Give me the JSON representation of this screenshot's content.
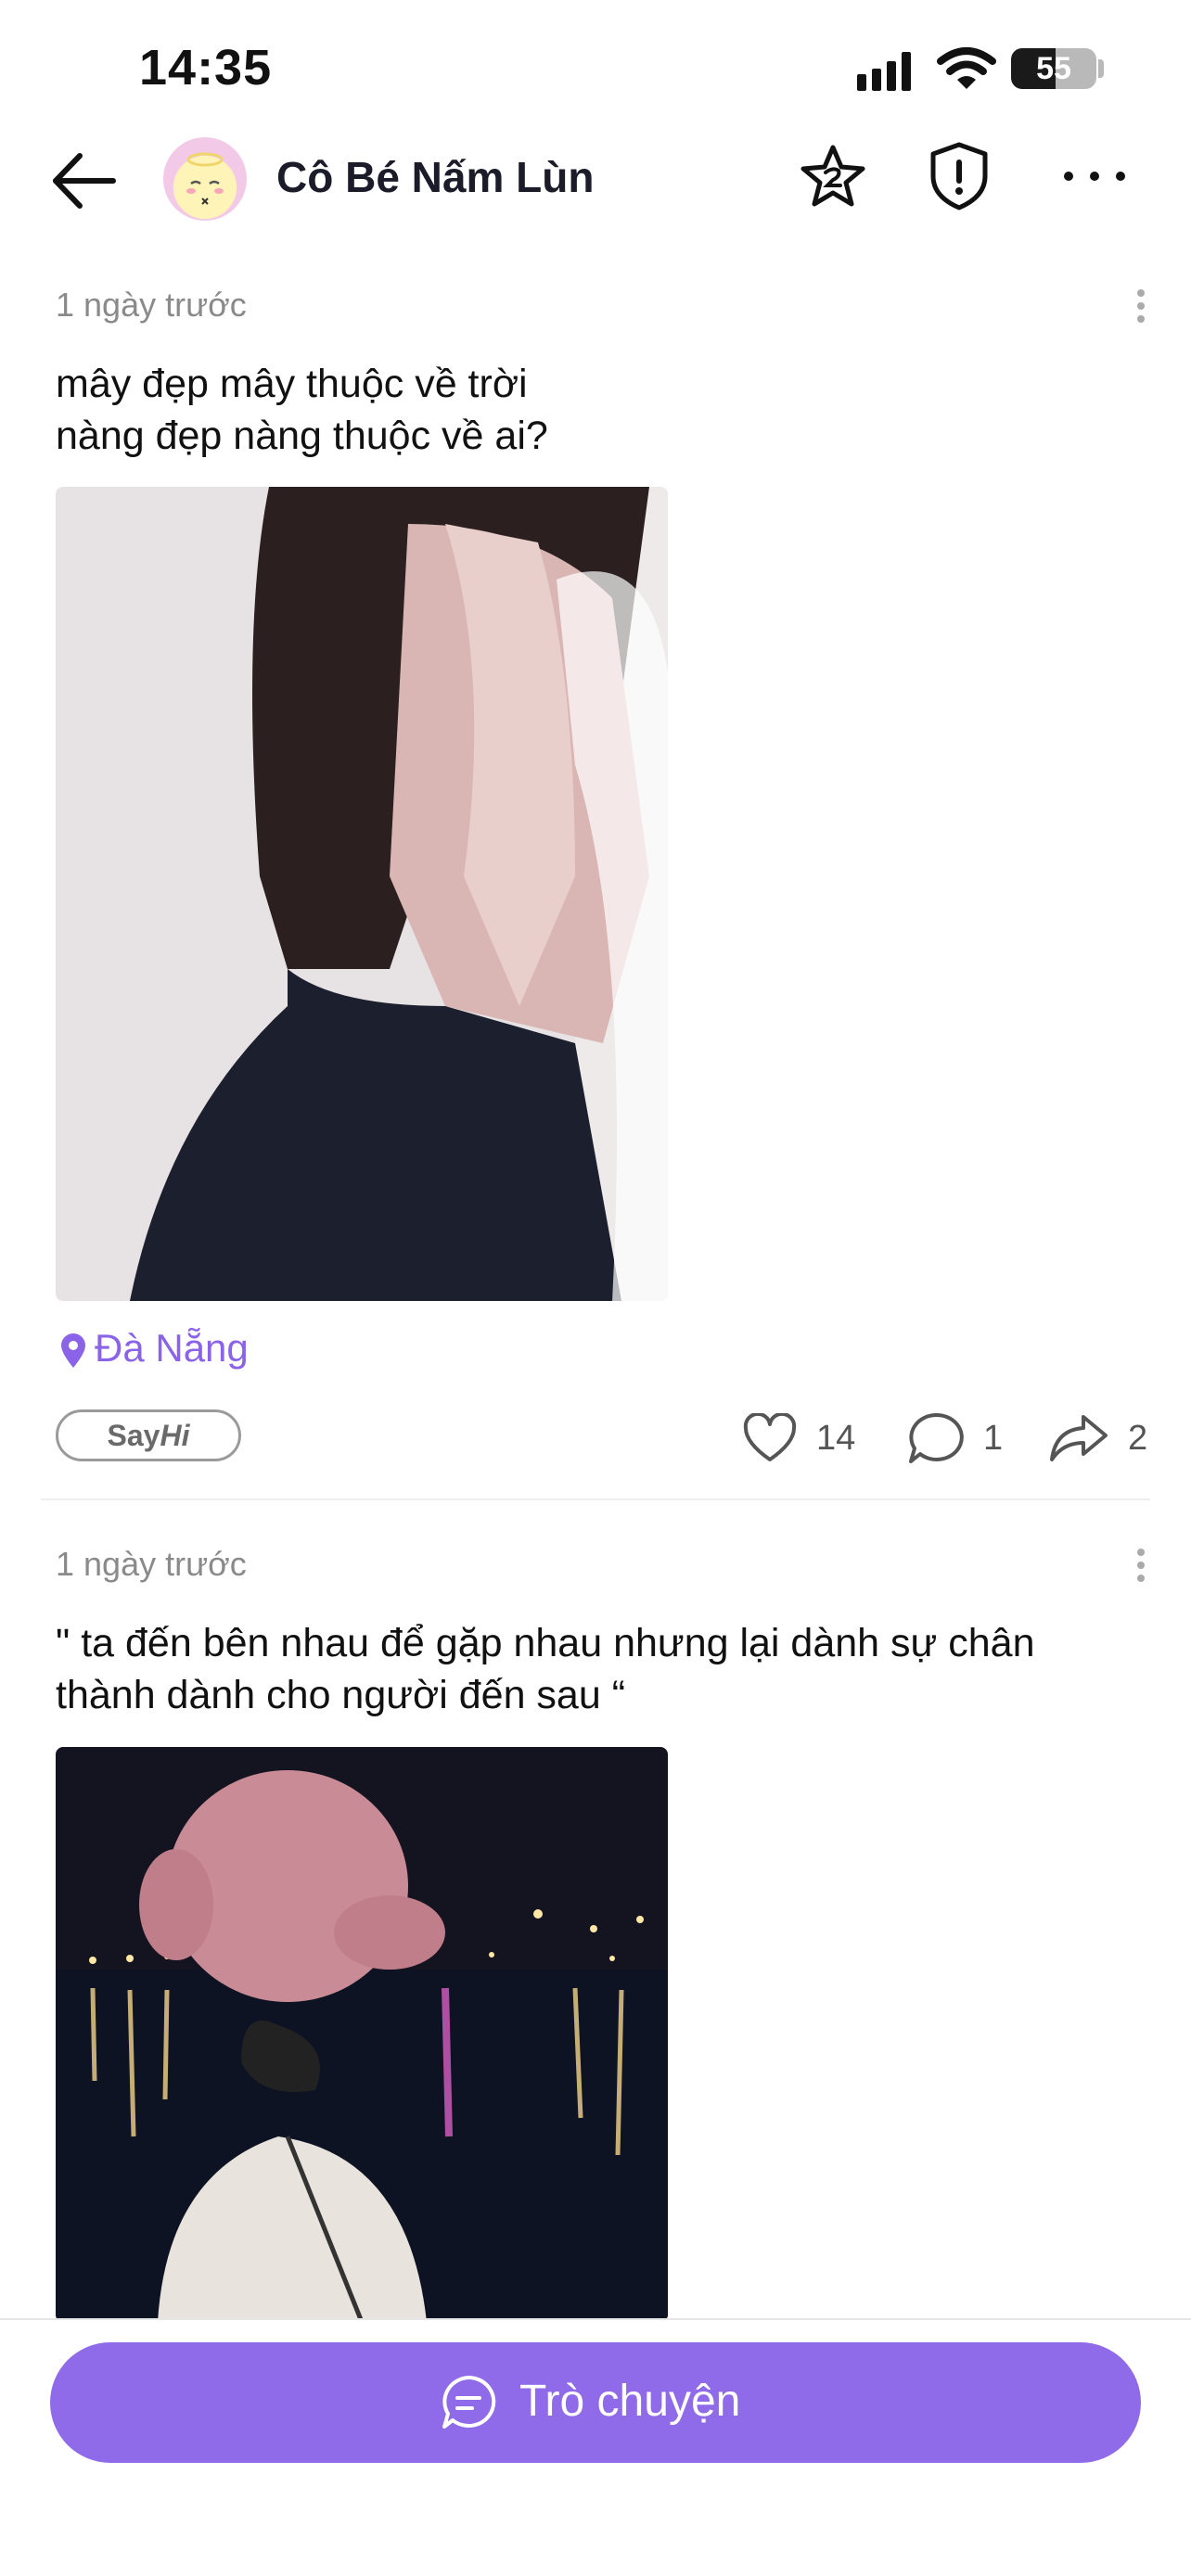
{
  "status_bar": {
    "time": "14:35",
    "battery": "55"
  },
  "header": {
    "username": "Cô Bé Nấm Lùn"
  },
  "posts": [
    {
      "time": "1 ngày trước",
      "text": "mây đẹp mây thuộc về trời\nnàng đẹp nàng thuộc về ai?",
      "location": "Đà Nẵng",
      "sayhi_prefix": "Say",
      "sayhi_suffix": "Hi",
      "likes": "14",
      "comments": "1",
      "shares": "2"
    },
    {
      "time": "1 ngày trước",
      "text": "\" ta đến bên nhau để gặp nhau nhưng lại dành sự chân thành dành cho người đến sau “"
    }
  ],
  "bottom": {
    "chat_label": "Trò chuyện"
  },
  "colors": {
    "accent": "#8f6bea",
    "location": "#8a63e8"
  }
}
